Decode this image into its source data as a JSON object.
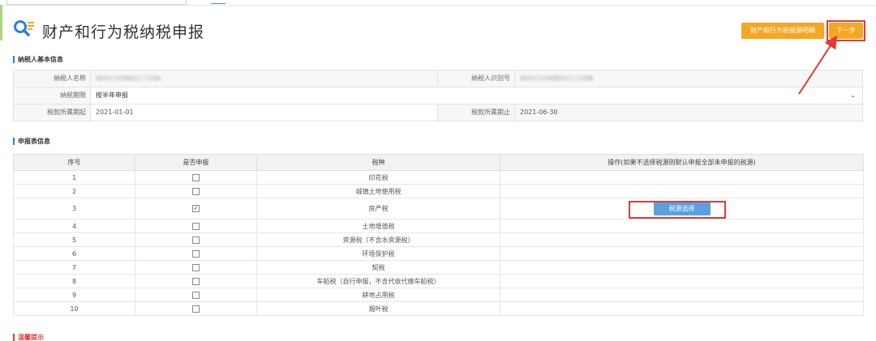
{
  "page": {
    "title": "财产和行为税纳税申报"
  },
  "header_buttons": {
    "detail": "财产和行为税税源明细",
    "next": "下一步"
  },
  "sections": {
    "taxpayer": "纳税人基本信息",
    "form": "申报表信息",
    "tips": "温馨提示"
  },
  "taxpayer": {
    "name_label": "纳税人名称",
    "id_label": "纳税人识别号",
    "period_label": "纳税期限",
    "period_value": "按半年申报",
    "start_label": "税款所属期起",
    "start_value": "2021-01-01",
    "end_label": "税款所属期止",
    "end_value": "2021-06-30"
  },
  "table": {
    "headers": [
      "序号",
      "是否申报",
      "税种",
      "操作(如果不选择税源则默认申报全部未申报的税源)"
    ],
    "rows": [
      {
        "no": "1",
        "checked": false,
        "tax": "印花税"
      },
      {
        "no": "2",
        "checked": false,
        "tax": "城镇土地使用税"
      },
      {
        "no": "3",
        "checked": true,
        "tax": "房产税",
        "action": "税源选择"
      },
      {
        "no": "4",
        "checked": false,
        "tax": "土地增值税"
      },
      {
        "no": "5",
        "checked": false,
        "tax": "资源税（不含水资源税）"
      },
      {
        "no": "6",
        "checked": false,
        "tax": "环境保护税"
      },
      {
        "no": "7",
        "checked": false,
        "tax": "契税"
      },
      {
        "no": "8",
        "checked": false,
        "tax": "车船税（自行申报，不含代收代缴车船税）"
      },
      {
        "no": "9",
        "checked": false,
        "tax": "耕地占用税"
      },
      {
        "no": "10",
        "checked": false,
        "tax": "烟叶税"
      }
    ]
  },
  "colors": {
    "accent_orange": "#f5a623",
    "annotation_red": "#e53935",
    "button_blue": "#5b9fe3"
  },
  "icons": [
    "search-doc-icon",
    "chevron-down-icon",
    "checkbox-icon",
    "arrow-annotation-icon"
  ]
}
